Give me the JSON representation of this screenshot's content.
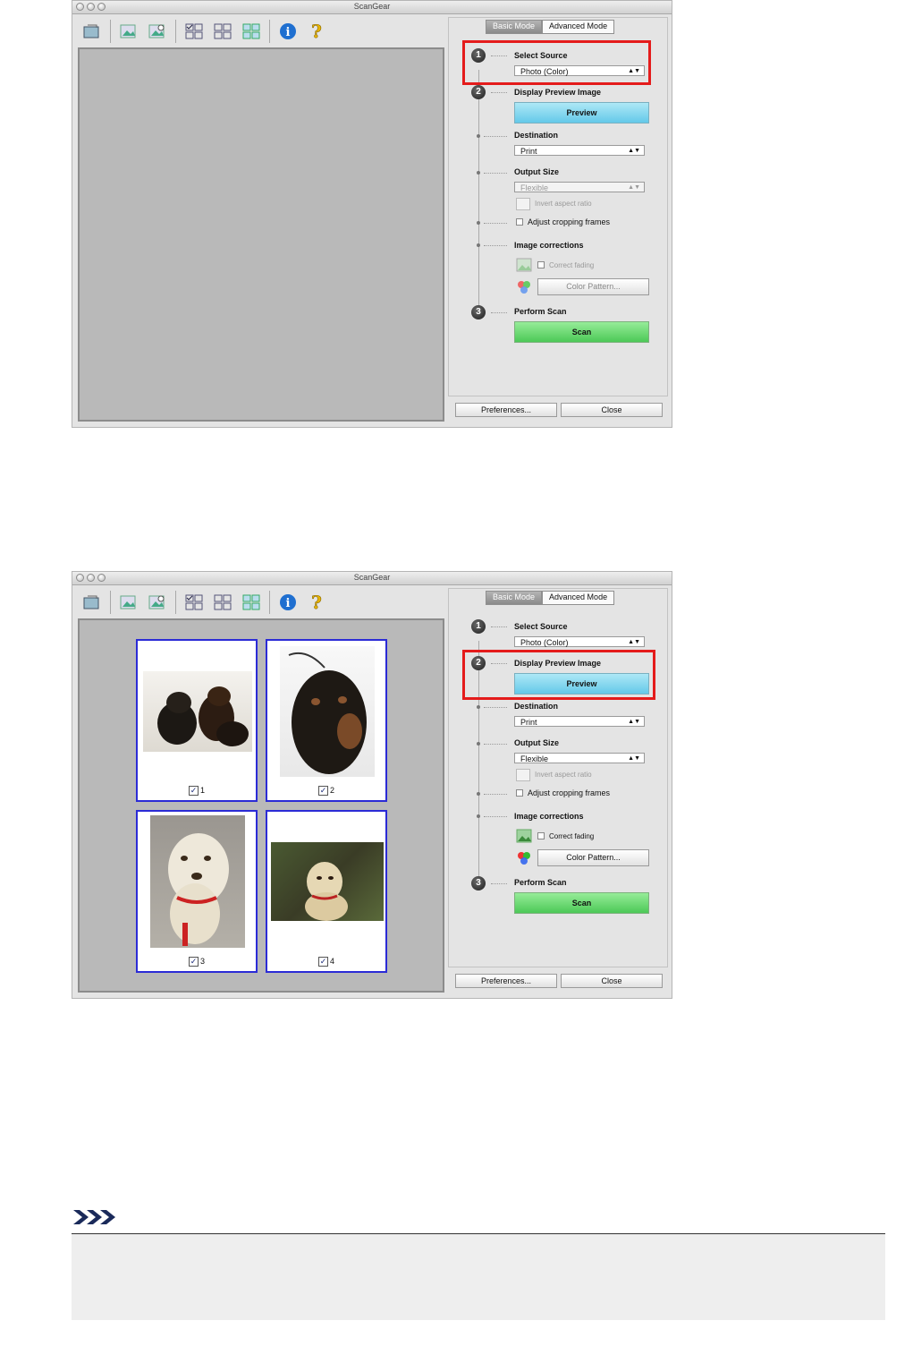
{
  "windows": [
    {
      "title": "ScanGear",
      "tabs": [
        {
          "label": "Basic Mode",
          "selected": true
        },
        {
          "label": "Advanced Mode",
          "selected": false
        }
      ],
      "steps": [
        {
          "number": "1"
        },
        {
          "number": "2"
        },
        {
          "number": "3"
        }
      ],
      "select_source": {
        "label": "Select Source",
        "value": "Photo (Color)"
      },
      "display_preview": {
        "label": "Display Preview Image",
        "button": "Preview"
      },
      "destination": {
        "label": "Destination",
        "value": "Print"
      },
      "output_size": {
        "label": "Output Size",
        "value": "Flexible",
        "enabled": false,
        "invert_label": "Invert aspect ratio"
      },
      "adjust_cropping": {
        "label": "Adjust cropping frames"
      },
      "image_corrections": {
        "label": "Image corrections",
        "correct_fading": "Correct fading",
        "color_pattern": "Color Pattern..."
      },
      "perform_scan": {
        "label": "Perform Scan",
        "button": "Scan"
      },
      "footer": {
        "preferences": "Preferences...",
        "close": "Close"
      },
      "highlight": "select-source"
    },
    {
      "title": "ScanGear",
      "tabs": [
        {
          "label": "Basic Mode",
          "selected": true
        },
        {
          "label": "Advanced Mode",
          "selected": false
        }
      ],
      "steps": [
        {
          "number": "1"
        },
        {
          "number": "2"
        },
        {
          "number": "3"
        }
      ],
      "select_source": {
        "label": "Select Source",
        "value": "Photo (Color)"
      },
      "display_preview": {
        "label": "Display Preview Image",
        "button": "Preview"
      },
      "destination": {
        "label": "Destination",
        "value": "Print"
      },
      "output_size": {
        "label": "Output Size",
        "value": "Flexible",
        "enabled": true,
        "invert_label": "Invert aspect ratio"
      },
      "adjust_cropping": {
        "label": "Adjust cropping frames"
      },
      "image_corrections": {
        "label": "Image corrections",
        "correct_fading": "Correct fading",
        "color_pattern": "Color Pattern..."
      },
      "perform_scan": {
        "label": "Perform Scan",
        "button": "Scan"
      },
      "footer": {
        "preferences": "Preferences...",
        "close": "Close"
      },
      "highlight": "display-preview",
      "thumbnails": [
        {
          "label": "1",
          "checked": true
        },
        {
          "label": "2",
          "checked": true
        },
        {
          "label": "3",
          "checked": true
        },
        {
          "label": "4",
          "checked": true
        }
      ]
    }
  ],
  "colors": {
    "highlight": "#e41b1b",
    "thumbnail_frame": "#2b2bd6",
    "preview_button": "#64c9e9",
    "scan_button": "#4cc957"
  }
}
